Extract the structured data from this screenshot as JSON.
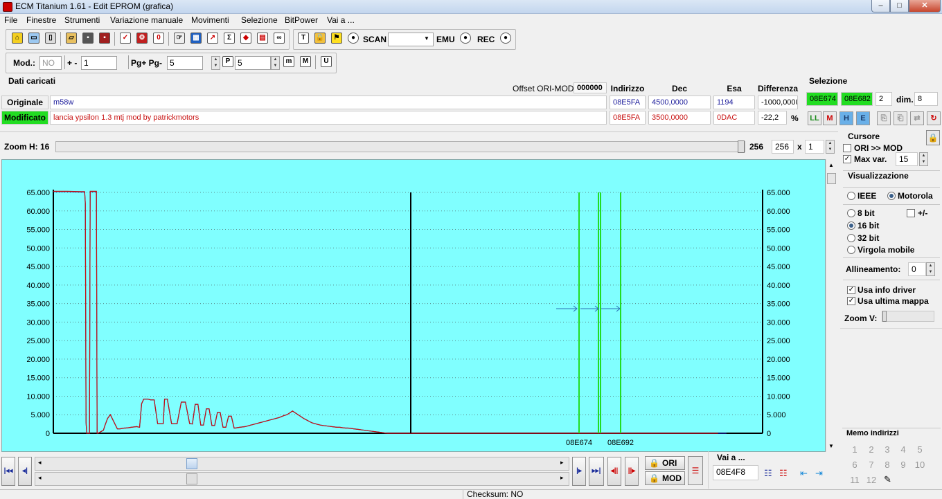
{
  "window": {
    "title": "ECM Titanium 1.61 - Edit EPROM (grafica)",
    "min": "–",
    "max": "□",
    "close": "✕"
  },
  "menu": [
    "File",
    "Finestre",
    "Strumenti",
    "Variazione manuale",
    "Movimenti",
    "Selezione",
    "BitPower",
    "Vai a ..."
  ],
  "toolbar": {
    "scan_label": "SCAN",
    "scan_value": "",
    "emu_label": "EMU",
    "rec_label": "REC"
  },
  "toolbar2": {
    "mod_label": "Mod.:",
    "mod_value": "NO",
    "plusminus_label": "+ -",
    "plusminus_value": "1",
    "pg_label": "Pg+ Pg-",
    "pg_value": "5",
    "p_value": "5"
  },
  "dati": {
    "title": "Dati caricati",
    "offset_label": "Offset ORI-MOD",
    "offset_value": "000000",
    "col_indirizzo": "Indirizzo",
    "col_dec": "Dec",
    "col_esa": "Esa",
    "col_diff": "Differenza",
    "originale_label": "Originale",
    "originale_name": "m58w",
    "originale_addr": "08E5FA",
    "originale_dec": "4500,0000",
    "originale_esa": "1194",
    "originale_diff": "-1000,0000",
    "modificato_label": "Modificato",
    "modificato_name": "lancia ypsilon 1.3 mtj mod by patrickmotors",
    "modificato_addr": "08E5FA",
    "modificato_dec": "3500,0000",
    "modificato_esa": "0DAC",
    "modificato_diff": "-22,2",
    "percent": "%"
  },
  "selezione": {
    "title": "Selezione",
    "start": "08E674",
    "end": "08E682",
    "count": "2",
    "dim_label": "dim.",
    "dim_value": "8"
  },
  "zoom": {
    "label": "Zoom H: 16",
    "value1": "256",
    "value2": "256",
    "x_label": "x",
    "mult": "1",
    "level": 1.0
  },
  "cursore": {
    "title": "Cursore",
    "ori_mod": "ORI >> MOD",
    "max_var": "Max var.",
    "max_var_value": "15"
  },
  "visualizzazione": {
    "title": "Visualizzazione",
    "ieee": "IEEE",
    "motorola": "Motorola",
    "b8": "8 bit",
    "pm": "+/-",
    "b16": "16 bit",
    "b32": "32 bit",
    "virgola": "Virgola mobile",
    "allineamento_label": "Allineamento:",
    "allineamento_value": "0",
    "usa_info": "Usa info driver",
    "usa_ultima": "Usa ultima mappa",
    "zoomv_label": "Zoom V:"
  },
  "memo": {
    "title": "Memo indirizzi",
    "items": [
      "1",
      "2",
      "3",
      "4",
      "5",
      "6",
      "7",
      "8",
      "9",
      "10",
      "11",
      "12"
    ]
  },
  "bottom": {
    "ori": "ORI",
    "mod": "MOD",
    "vai_label": "Vai a ...",
    "vai_value": "08E4F8",
    "nav1": "|◂◂",
    "nav2": "◂|",
    "nav3": "|▸",
    "nav4": "▸▸|",
    "nav5": "◂||",
    "nav6": "||▸"
  },
  "status": {
    "checksum": "Checksum: NO"
  },
  "colors": {
    "plot_bg": "#80ffff",
    "ori": "#1e1e9c",
    "mod": "#c81010",
    "cursor": "#000000",
    "sel": "#22dd22",
    "arrow": "#2a6fb4"
  },
  "chart_data": {
    "type": "line",
    "title": "",
    "ylim": [
      0,
      65000
    ],
    "yticks": [
      "65.000",
      "60.000",
      "55.000",
      "50.000",
      "45.000",
      "40.000",
      "35.000",
      "30.000",
      "25.000",
      "20.000",
      "15.000",
      "10.000",
      "5.000",
      "0"
    ],
    "xlabel": "",
    "ylabel": "",
    "x_markers": [
      "08E674",
      "08E692"
    ],
    "x": [
      0,
      20,
      40,
      45,
      46,
      47,
      48,
      52,
      53,
      54,
      62,
      63,
      64,
      72,
      74,
      78,
      82,
      92,
      94,
      96,
      99,
      102,
      104,
      108,
      112,
      120,
      124,
      127,
      130,
      136,
      140,
      145,
      150,
      158,
      160,
      164,
      170,
      178,
      184,
      190,
      196,
      200,
      204,
      208,
      212,
      216,
      220,
      224,
      228,
      232,
      236,
      240,
      244,
      248,
      252,
      256,
      260,
      262,
      264,
      268,
      272,
      276,
      280,
      284,
      288,
      292,
      296,
      300,
      304,
      308,
      312,
      316,
      320,
      324,
      328,
      332,
      336,
      340,
      344,
      348,
      352,
      356,
      360,
      364,
      368,
      372,
      376,
      380,
      384,
      388,
      392,
      396,
      400,
      404,
      408,
      412,
      416,
      420,
      424,
      428,
      432,
      436,
      440,
      444,
      448,
      452,
      456,
      460,
      464,
      468,
      472,
      476,
      480,
      484,
      488,
      492,
      496,
      500,
      504,
      508,
      512,
      516,
      520,
      524,
      528,
      532,
      536,
      540,
      544,
      548,
      552,
      556,
      560,
      564,
      568,
      572,
      576,
      580,
      584,
      588,
      592,
      596,
      600,
      604,
      608,
      612,
      616,
      620,
      624,
      628,
      632,
      636,
      640,
      644,
      648,
      652,
      656,
      660,
      664,
      668,
      672,
      676,
      680,
      684,
      688,
      692,
      696,
      700,
      704,
      708,
      712,
      716,
      720,
      724,
      728,
      732,
      736,
      740,
      744,
      748,
      752,
      756,
      760,
      764,
      768,
      772,
      776,
      780,
      784,
      788,
      792,
      796,
      800,
      804,
      808,
      812,
      816,
      820,
      824,
      828,
      832,
      836,
      840,
      844,
      848,
      852,
      856,
      860,
      864,
      868,
      872,
      876,
      880,
      884,
      888,
      892,
      896,
      900,
      904,
      908,
      912,
      916,
      920,
      924,
      928,
      932,
      936,
      940,
      944,
      948,
      952,
      956,
      960,
      964,
      968,
      972,
      976,
      980,
      984,
      988,
      992,
      996,
      1000,
      1004,
      1008,
      1012,
      1016,
      1020
    ],
    "series": [
      {
        "name": "ORI",
        "values": [
          65200,
          65200,
          65100,
          65100,
          62000,
          3000,
          0,
          0,
          65200,
          65200,
          65200,
          0,
          0,
          800,
          2000,
          4000,
          5000,
          1200,
          1200,
          1200,
          1300,
          1400,
          1400,
          1500,
          1600,
          1800,
          1600,
          8000,
          9200,
          9200,
          9000,
          9000,
          2600,
          2600,
          9200,
          9200,
          2600,
          2600,
          8400,
          8400,
          2600,
          2500,
          7800,
          7800,
          2200,
          2200,
          6600,
          6600,
          2100,
          2100,
          5600,
          5600,
          1600,
          1600,
          4600,
          4600,
          1400,
          1400,
          1500,
          1600,
          1700,
          1800,
          2000,
          2200,
          2400,
          2600,
          2800,
          3000,
          3200,
          3400,
          3600,
          3800,
          4000,
          4200,
          4500,
          4800,
          5000,
          5500,
          6000,
          5500,
          5000,
          4500,
          4000,
          3600,
          3200,
          2800,
          2600,
          2400,
          2200,
          2100,
          2000,
          1900,
          1800,
          1700,
          1600,
          1600,
          1500,
          1400,
          1400,
          1300,
          1200,
          1100,
          1000,
          900,
          800,
          700,
          600,
          500,
          400,
          300,
          200,
          100,
          0,
          0,
          0,
          0,
          0,
          0,
          0,
          0,
          0,
          0,
          0,
          0,
          0,
          0,
          0,
          0,
          0,
          0,
          0,
          0,
          0,
          0,
          0,
          0,
          0,
          0,
          0,
          0,
          0,
          0,
          0,
          0,
          0,
          0,
          0,
          0,
          0,
          0,
          0,
          0,
          0,
          0,
          0,
          0,
          0,
          0,
          0,
          0,
          0,
          0,
          0,
          0,
          0,
          0,
          0,
          0,
          0,
          0,
          0,
          0,
          0,
          0,
          0,
          0,
          0,
          0,
          0,
          0,
          0,
          0,
          0,
          0,
          0,
          0,
          0,
          0,
          0,
          0,
          0,
          0,
          0,
          0,
          0,
          0,
          0,
          0,
          0,
          0,
          0,
          0,
          0,
          0,
          0,
          0,
          0,
          0,
          0,
          0,
          0,
          0,
          0,
          0,
          0,
          0,
          0,
          0,
          0,
          0,
          0,
          0,
          0,
          0,
          0,
          0,
          0,
          0,
          0,
          0,
          0,
          0,
          0,
          0,
          0
        ]
      },
      {
        "name": "MOD",
        "values": [
          65300,
          65300,
          65200,
          65200,
          62000,
          3000,
          0,
          0,
          65300,
          65300,
          65300,
          0,
          0,
          800,
          2000,
          4000,
          5000,
          1200,
          1200,
          1200,
          1300,
          1400,
          1400,
          1500,
          1600,
          1800,
          1600,
          8000,
          9200,
          9200,
          9000,
          9000,
          2600,
          2600,
          9200,
          9200,
          2600,
          2600,
          8400,
          8400,
          2600,
          2500,
          7800,
          7800,
          2200,
          2200,
          6600,
          6600,
          2100,
          2100,
          5600,
          5600,
          1600,
          1600,
          4600,
          4600,
          1400,
          1400,
          1500,
          1600,
          1700,
          1800,
          2000,
          2200,
          2400,
          2600,
          2800,
          3000,
          3200,
          3400,
          3600,
          3800,
          4000,
          4200,
          4500,
          4800,
          5000,
          5500,
          6000,
          5500,
          5000,
          4500,
          4000,
          3600,
          3200,
          2800,
          2600,
          2400,
          2200,
          2100,
          2000,
          1900,
          1800,
          1700,
          1600,
          1600,
          1500,
          1400,
          1400,
          1300,
          1200,
          1100,
          1000,
          900,
          800,
          700,
          600,
          500,
          400,
          300,
          200,
          100,
          0,
          0,
          0,
          0,
          0,
          0,
          0,
          0,
          0,
          0,
          0,
          0,
          0,
          0,
          0,
          0,
          0,
          0,
          0,
          0,
          0,
          0,
          0,
          0,
          0,
          0,
          0,
          0,
          0,
          0,
          0,
          0,
          0,
          0,
          0,
          0,
          0,
          0,
          0,
          0,
          0,
          0,
          0,
          0,
          0,
          0,
          0,
          0,
          0,
          0,
          0,
          0,
          0,
          0,
          0,
          0,
          0,
          0,
          0,
          0,
          0,
          0,
          0,
          0,
          0,
          0,
          0,
          0,
          0,
          0,
          0,
          0,
          0,
          0,
          0,
          0,
          0,
          0,
          0,
          0,
          0,
          0,
          0,
          0,
          0,
          0,
          0,
          0,
          0,
          0,
          0,
          0,
          0,
          0,
          0,
          0,
          0,
          0,
          0,
          0,
          0,
          0,
          0,
          0,
          0,
          0,
          0,
          0,
          0,
          0,
          0,
          0,
          0,
          0,
          0,
          0,
          0,
          0,
          0,
          0
        ]
      }
    ]
  }
}
